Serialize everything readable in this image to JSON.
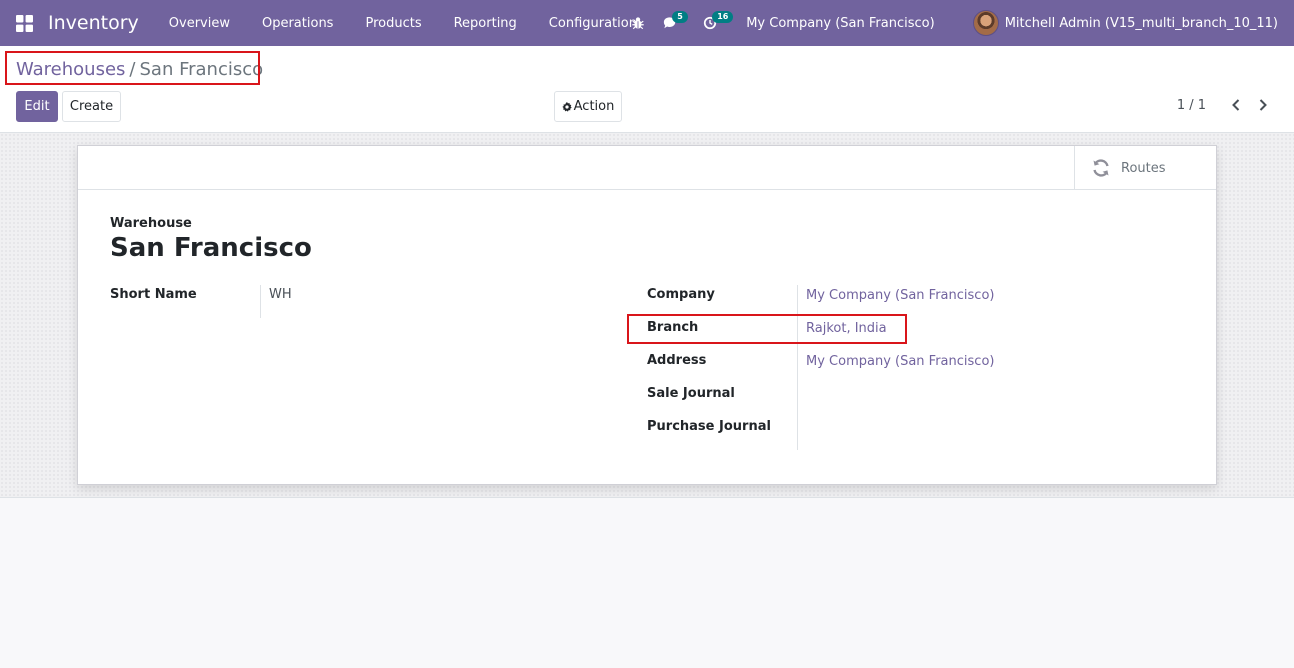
{
  "navbar": {
    "app_name": "Inventory",
    "menu": [
      "Overview",
      "Operations",
      "Products",
      "Reporting",
      "Configuration"
    ],
    "messages_count": "5",
    "activities_count": "16",
    "company": "My Company (San Francisco)",
    "user": "Mitchell Admin (V15_multi_branch_10_11)"
  },
  "breadcrumb": {
    "parent": "Warehouses",
    "separator": "/",
    "current": "San Francisco"
  },
  "buttons": {
    "edit": "Edit",
    "create": "Create",
    "action": "Action"
  },
  "pager": {
    "value": "1 / 1"
  },
  "form": {
    "smart_button": "Routes",
    "caption": "Warehouse",
    "title": "San Francisco",
    "short_name_label": "Short Name",
    "short_name_value": "WH",
    "company_label": "Company",
    "company_value": "My Company (San Francisco)",
    "branch_label": "Branch",
    "branch_value": "Rajkot, India",
    "address_label": "Address",
    "address_value": "My Company (San Francisco)",
    "sale_journal_label": "Sale Journal",
    "purchase_journal_label": "Purchase Journal"
  },
  "colors": {
    "brand": "#71639e",
    "badge": "#017e84",
    "highlight": "#d9151a"
  }
}
